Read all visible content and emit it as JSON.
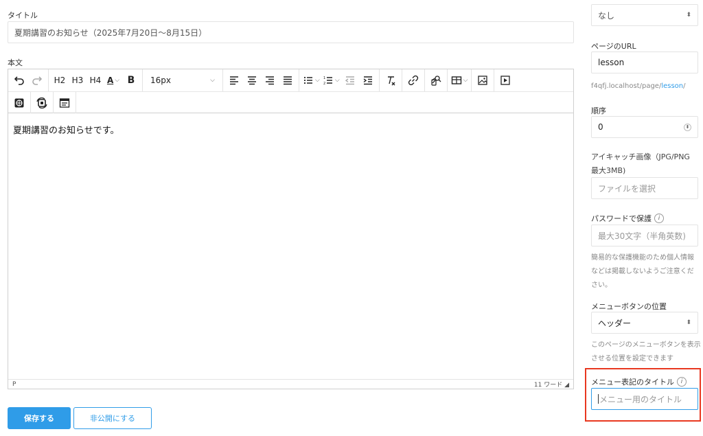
{
  "title_section": {
    "label": "タイトル",
    "value": "夏期講習のお知らせ（2025年7月20日〜8月15日）"
  },
  "body_section": {
    "label": "本文"
  },
  "toolbar": {
    "h2": "H2",
    "h3": "H3",
    "h4": "H4",
    "bold": "B",
    "font_color": "A",
    "font_size": "16px"
  },
  "editor": {
    "content": "夏期講習のお知らせです。",
    "status_path": "P",
    "word_count": "11 ワード"
  },
  "actions": {
    "save": "保存する",
    "unpublish": "非公開にする"
  },
  "sidebar": {
    "parent_page_value": "なし",
    "url_label": "ページのURL",
    "url_value": "lesson",
    "url_prefix": "f4qfj.localhost/page/",
    "url_slug": "lesson",
    "url_suffix": "/",
    "order_label": "順序",
    "order_value": "0",
    "eyecatch_label": "アイキャッチ画像（JPG/PNG 最大3MB)",
    "eyecatch_placeholder": "ファイルを選択",
    "password_label": "パスワードで保護",
    "password_placeholder": "最大30文字（半角英数)",
    "password_hint": "簡易的な保護機能のため個人情報などは掲載しないようご注意ください。",
    "menu_pos_label": "メニューボタンの位置",
    "menu_pos_value": "ヘッダー",
    "menu_pos_hint": "このページのメニューボタンを表示させる位置を設定できます",
    "menu_title_label": "メニュー表記のタイトル",
    "menu_title_placeholder": "メニュー用のタイトル"
  },
  "colors": {
    "accent": "#2f9ce8",
    "highlight": "#e8371f"
  }
}
